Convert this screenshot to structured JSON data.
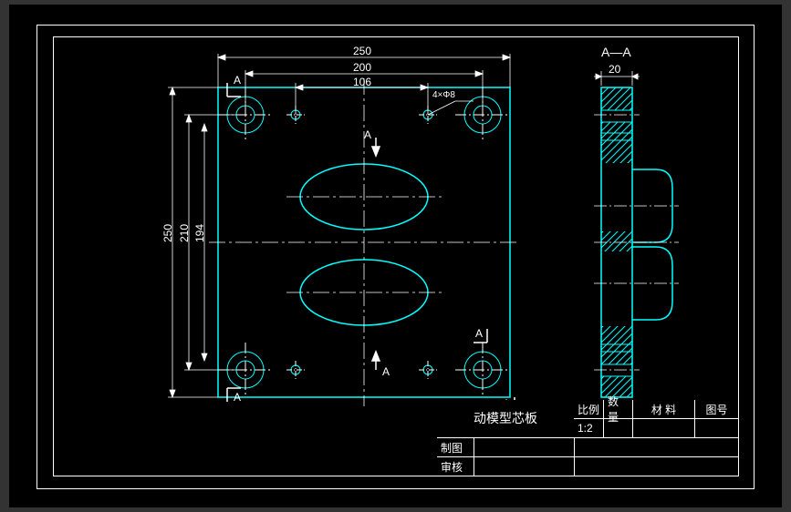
{
  "drawing": {
    "title": "动模型芯板",
    "section_label": "A—A",
    "section_marks": {
      "a_top": "A",
      "a_bottom": "A"
    }
  },
  "dimensions": {
    "top": {
      "d250": "250",
      "d200": "200",
      "d106": "106",
      "holes": "4×Φ8"
    },
    "left": {
      "d250v": "250",
      "d210": "210",
      "d194": "194"
    },
    "right": {
      "d20": "20"
    }
  },
  "title_block": {
    "scale_label": "比例",
    "scale_value": "1:2",
    "qty_label": "数量",
    "material_label": "材  料",
    "dwgno_label": "图号",
    "drawn_label": "制图",
    "checked_label": "审核"
  }
}
